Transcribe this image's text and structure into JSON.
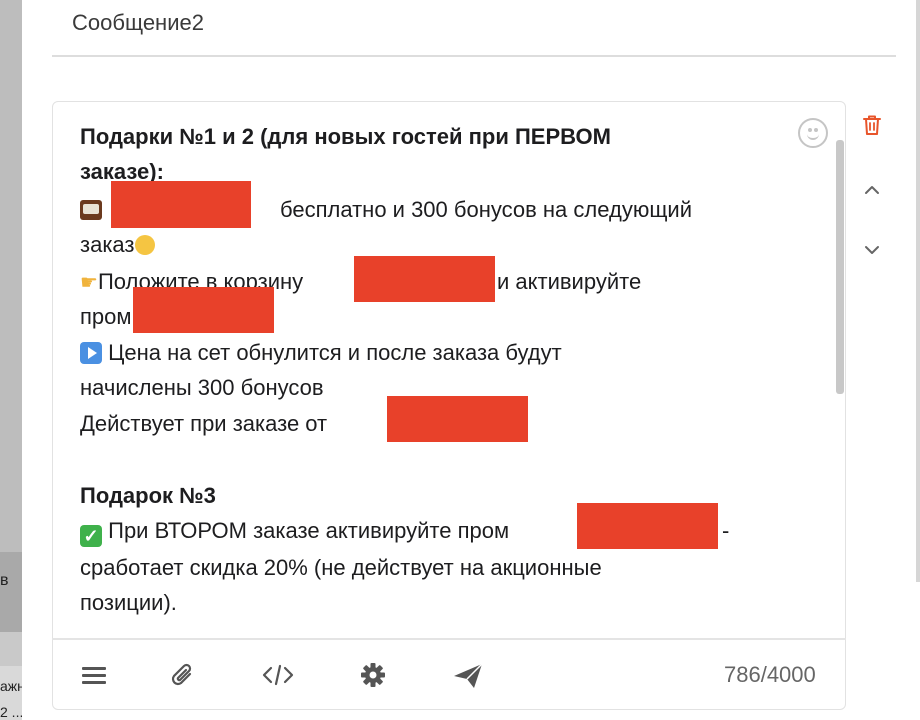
{
  "modal": {
    "field_title": "Сообщение2",
    "message_lines": [
      "Подарки №1 и 2 (для новых гостей при ПЕРВОМ",
      "заказе):",
      "бесплатно и 300 бонусов на следующий",
      "заказ",
      "Положите в корзину",
      "и активируйте",
      "пром",
      "Цена на сет обнулится и после заказа будут",
      "начислены 300 бонусов",
      "Действует при заказе от",
      "Подарок №3",
      "При ВТОРОМ заказе активируйте пром",
      "-",
      "сработает скидка 20% (не действует на акционные",
      "позиции)."
    ],
    "char_counter": "786/4000",
    "toolbar_icons": [
      "menu-icon",
      "paperclip-icon",
      "code-icon",
      "gear-icon",
      "send-icon"
    ],
    "side_icons": [
      "trash-icon",
      "chevron-up-icon",
      "chevron-down-icon"
    ],
    "colors": {
      "redaction": "#e8412a",
      "trash": "#e8552b",
      "icon_gray": "#555555"
    }
  },
  "background": {
    "fragments": [
      "в",
      "ажн",
      "2 ..."
    ]
  }
}
